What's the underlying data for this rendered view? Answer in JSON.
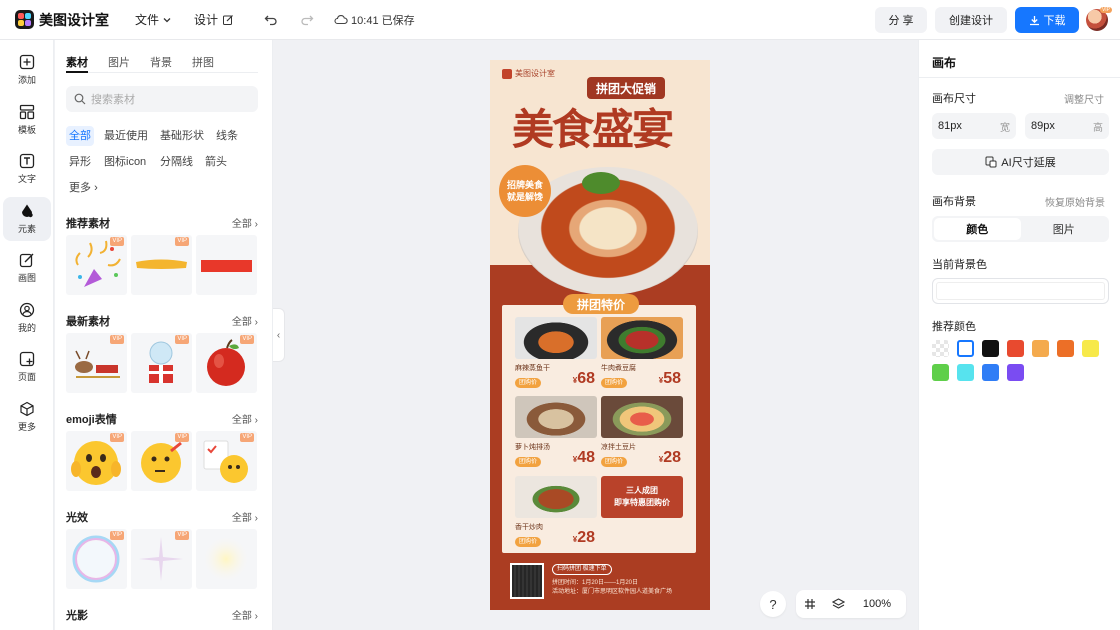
{
  "app": {
    "name": "美图设计室",
    "menu_file": "文件",
    "menu_design": "设计",
    "save_status": "10:41 已保存",
    "share": "分 享",
    "create": "创建设计",
    "download": "下载",
    "avatar_badge": "VIP"
  },
  "rail": [
    {
      "label": "添加",
      "icon": "plus-square-icon"
    },
    {
      "label": "模板",
      "icon": "template-icon"
    },
    {
      "label": "文字",
      "icon": "text-icon"
    },
    {
      "label": "元素",
      "icon": "element-icon"
    },
    {
      "label": "画图",
      "icon": "draw-icon"
    },
    {
      "label": "我的",
      "icon": "user-icon"
    },
    {
      "label": "页面",
      "icon": "page-icon"
    },
    {
      "label": "更多",
      "icon": "cube-icon"
    }
  ],
  "panel": {
    "tabs": [
      "素材",
      "图片",
      "背景",
      "拼图"
    ],
    "search_placeholder": "搜索素材",
    "chips": [
      "全部",
      "最近使用",
      "基础形状",
      "线条",
      "异形",
      "图标icon",
      "分隔线",
      "箭头",
      "更多"
    ],
    "vip": "VIP",
    "sections": [
      {
        "title": "推荐素材",
        "all": "全部"
      },
      {
        "title": "最新素材",
        "all": "全部"
      },
      {
        "title": "emoji表情",
        "all": "全部"
      },
      {
        "title": "光效",
        "all": "全部"
      },
      {
        "title": "光影",
        "all": "全部"
      }
    ]
  },
  "poster": {
    "brand": "美图设计室",
    "badge": "拼团大促销",
    "title": "美食盛宴",
    "circle_line1": "招牌美食",
    "circle_line2": "就是解馋",
    "card_tag": "拼团特价",
    "dishes": [
      {
        "name": "麻辣蒸鱼干",
        "tag": "团购价",
        "currency": "¥",
        "price": "68"
      },
      {
        "name": "牛肉煮豆腐",
        "tag": "团购价",
        "currency": "¥",
        "price": "58"
      },
      {
        "name": "萝卜炖排汤",
        "tag": "团购价",
        "currency": "¥",
        "price": "48"
      },
      {
        "name": "凉拌土豆片",
        "tag": "团购价",
        "currency": "¥",
        "price": "28"
      },
      {
        "name": "香干炒肉",
        "tag": "团购价",
        "currency": "¥",
        "price": "28"
      }
    ],
    "promo_line1": "三人成团",
    "promo_line2": "即享特惠团购价",
    "foot_button": "扫码拼团 极速下单",
    "foot_line1": "拼团时间：1月20日——1月20日",
    "foot_line2": "活动地址：厦门市思明区软件园人道美食广场"
  },
  "canvas_tools": {
    "help": "?",
    "zoom": "100%"
  },
  "right": {
    "title": "画布",
    "size_label": "画布尺寸",
    "resize_link": "调整尺寸",
    "width_value": "81px",
    "width_unit": "宽",
    "height_value": "89px",
    "height_unit": "高",
    "ai_button": "AI尺寸延展",
    "bg_label": "画布背景",
    "bg_reset": "恢复原始背景",
    "seg_color": "颜色",
    "seg_image": "图片",
    "current_bg_label": "当前背景色",
    "recommend_label": "推荐颜色",
    "swatches": [
      "transparent",
      "#ffffff",
      "#111111",
      "#e84a2f",
      "#f4aa4d",
      "#ec6f27",
      "#f7e94a",
      "#5fcf4a",
      "#57e3ee",
      "#2f7df6",
      "#7a4cf2"
    ]
  }
}
